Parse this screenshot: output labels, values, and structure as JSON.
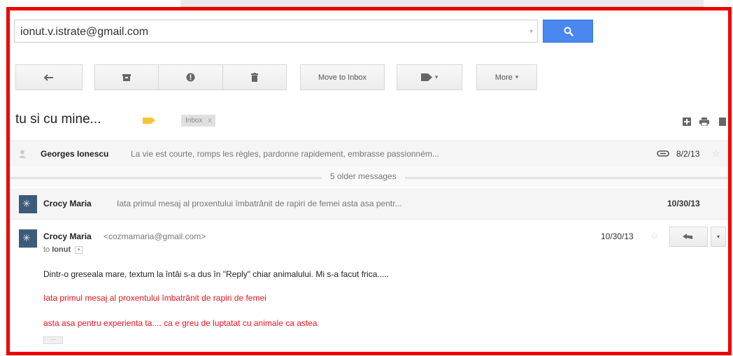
{
  "search": {
    "value": "ionut.v.istrate@gmail.com"
  },
  "toolbar": {
    "move_to_inbox": "Move to Inbox",
    "more": "More"
  },
  "thread": {
    "subject": "tu si cu mine...",
    "label": "Inbox",
    "label_close": "x"
  },
  "messages": [
    {
      "sender": "Georges Ionescu",
      "snippet": "La vie est courte, romps les règles, pardonne rapidement, embrasse passionném...",
      "date": "8/2/13"
    },
    {
      "sender": "Crocy Maria",
      "snippet": "Iata primul mesaj al proxentului îmbatrânit de rapiri de femei asta asa pentr...",
      "date": "10/30/13"
    }
  ],
  "older_messages": "5 older messages",
  "open_message": {
    "sender": "Crocy Maria",
    "email": "<cozmamaria@gmail.com>",
    "to_prefix": "to",
    "to_name": "Ionut",
    "date": "10/30/13",
    "body_line_1": "Dintr-o greseala mare, textum la întâi s-a dus în \"Reply\" chiar animalului. Mi s-a facut frica.....",
    "body_line_2": "Iata primul mesaj al proxentului îmbatrânit de rapiri de femei",
    "body_line_3": "asta asa pentru experienta ta.... ca e greu de luptatat cu animale ca astea"
  },
  "colors": {
    "frame": "#ee0000",
    "search_button": "#4a87ee",
    "quoted_text": "#e8141e",
    "important_tag": "#f5c531"
  }
}
